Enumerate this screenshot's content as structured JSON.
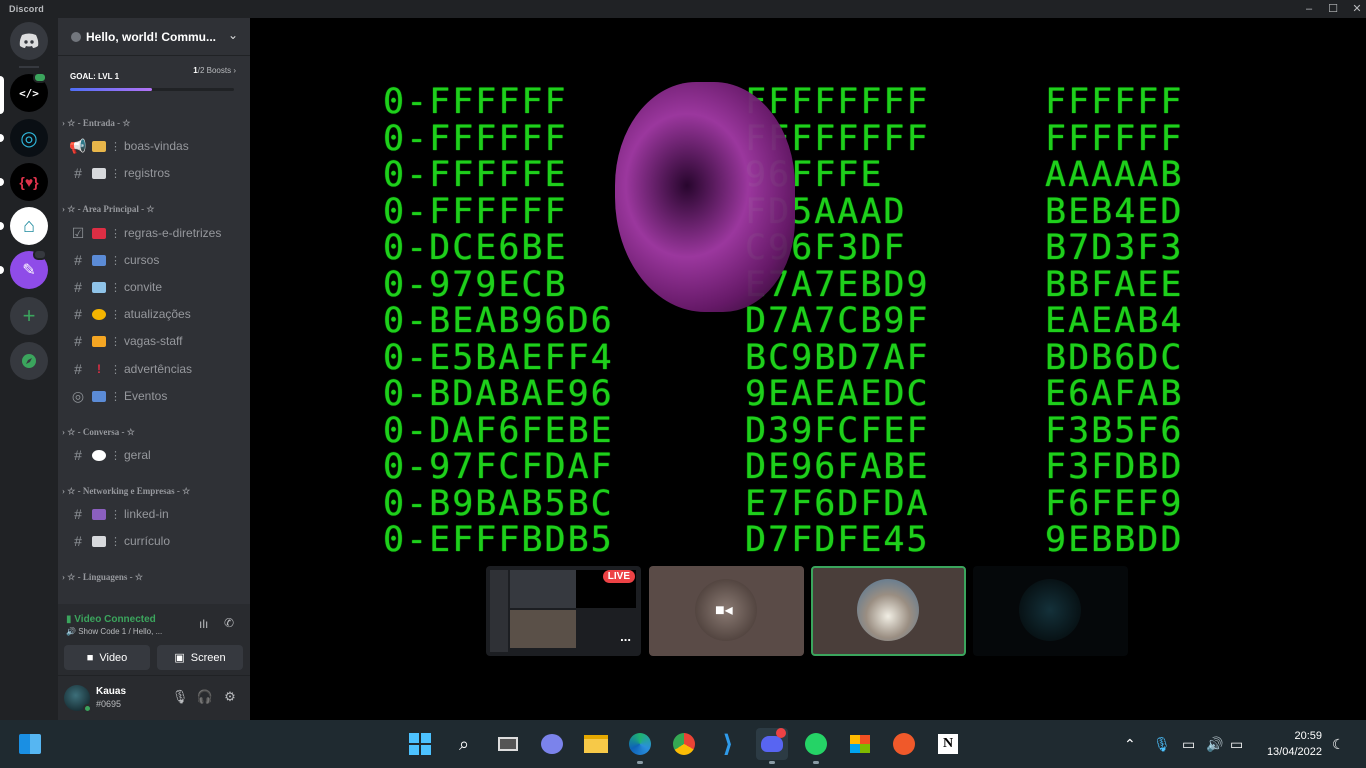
{
  "window": {
    "app_name": "Discord",
    "controls": [
      "minimize-icon",
      "maximize-icon",
      "close-icon"
    ]
  },
  "server_rail": {
    "home_icon": "discord-logo-icon",
    "servers": [
      {
        "name": "code-server",
        "glyph": "</>",
        "active": true
      },
      {
        "name": "server-2",
        "glyph": "◎"
      },
      {
        "name": "server-3",
        "glyph": "{♥}"
      },
      {
        "name": "server-4",
        "glyph": "⌂"
      },
      {
        "name": "server-5",
        "glyph": "✎"
      }
    ],
    "add_server_icon": "plus-icon",
    "explore_icon": "compass-icon"
  },
  "guild": {
    "name": "Hello, world! Commu...",
    "boost_goal": "GOAL: LVL 1",
    "boost_current": "1",
    "boost_total": "/2 Boosts",
    "boost_progress": 0.5
  },
  "categories": [
    {
      "label": "☆ - Entrada - ☆",
      "channels": [
        {
          "icon": "megaphone-icon",
          "emoji": "👋",
          "label": "boas-vindas"
        },
        {
          "icon": "hash-icon",
          "emoji": "📄",
          "label": "registros"
        }
      ]
    },
    {
      "label": "☆ - Area Principal - ☆",
      "channels": [
        {
          "icon": "rules-icon",
          "emoji": "📢",
          "label": "regras-e-diretrizes"
        },
        {
          "icon": "hash-icon",
          "emoji": "📚",
          "label": "cursos"
        },
        {
          "icon": "hash-icon",
          "emoji": "📧",
          "label": "convite"
        },
        {
          "icon": "hash-icon",
          "emoji": "🔔",
          "label": "atualizações"
        },
        {
          "icon": "hash-icon",
          "emoji": "💥",
          "label": "vagas-staff"
        },
        {
          "icon": "hash-icon",
          "emoji": "❗",
          "label": "advertências"
        },
        {
          "icon": "stage-icon",
          "emoji": "📅",
          "label": "Eventos"
        }
      ]
    },
    {
      "label": "☆ - Conversa - ☆",
      "channels": [
        {
          "icon": "hash-icon",
          "emoji": "💬",
          "label": "geral"
        }
      ]
    },
    {
      "label": "☆ - Networking e Empresas - ☆",
      "channels": [
        {
          "icon": "hash-icon",
          "emoji": "👥",
          "label": "linked-in"
        },
        {
          "icon": "hash-icon",
          "emoji": "📄",
          "label": "currículo"
        }
      ]
    },
    {
      "label": "☆ - Linguagens - ☆",
      "channels": []
    }
  ],
  "voice": {
    "status": "Video Connected",
    "channel": "Show Code 1 / Hello, ...",
    "video_label": "Video",
    "screen_label": "Screen"
  },
  "user": {
    "name": "Kauas",
    "tag": "#0695"
  },
  "stream": {
    "columns": [
      [
        "0-FFFFFF",
        "0-FFFFFF",
        "0-FFFFFE",
        "0-FFFFFF",
        "0-DCE6BE",
        "0-979ECB",
        "0-BEAB96D6",
        "0-E5BAEFF4",
        "0-BDABAE96",
        "0-DAF6FEBE",
        "0-97FCFDAF",
        "0-B9BAB5BC",
        "0-EFFFBDB5"
      ],
      [
        "FFFFFFFF",
        "FFFFFFFF",
        "96FFFE",
        "FD5AAAD",
        "C96F3DF",
        "E7A7EBD9",
        "D7A7CB9F",
        "BC9BD7AF",
        "9EAEAEDC",
        "D39FCFEF",
        "DE96FABE",
        "E7F6DFDA",
        "D7FDFE45"
      ],
      [
        "FFFFFF",
        "FFFFFF",
        "AAAAAB",
        "BEB4ED",
        "B7D3F3",
        "BBFAEE",
        "EAEAB4",
        "BDB6DC",
        "E6AFAB",
        "F3B5F6",
        "F3FDBD",
        "F6FEF9",
        "9EBBDD"
      ]
    ]
  },
  "participants": [
    {
      "name": "screen-share-tile",
      "live_label": "LIVE",
      "more_label": "..."
    },
    {
      "name": "camera-tile-1"
    },
    {
      "name": "camera-tile-2",
      "speaking": true
    },
    {
      "name": "camera-tile-3"
    }
  ],
  "taskbar": {
    "apps": [
      "windows-start-icon",
      "search-icon",
      "task-view-icon",
      "chat-icon",
      "file-explorer-icon",
      "edge-icon",
      "chrome-icon",
      "vscode-icon",
      "discord-icon",
      "whatsapp-icon",
      "store-icon",
      "app-icon",
      "notion-icon"
    ],
    "time": "20:59",
    "date": "13/04/2022"
  }
}
